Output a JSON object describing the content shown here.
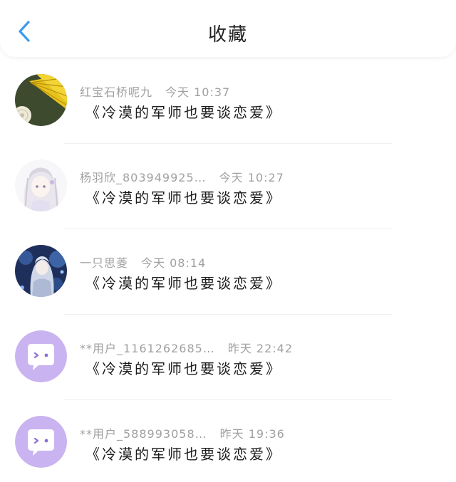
{
  "header": {
    "title": "收藏",
    "back_icon": "chevron-left-icon",
    "accent": "#3a9bf0"
  },
  "items": [
    {
      "user": "红宝石桥呢九",
      "time": "今天 10:37",
      "book": "《冷漠的军师也要谈恋爱》",
      "avatar": "yellow-fan-avatar"
    },
    {
      "user": "杨羽欣_803949925…",
      "time": "今天 10:27",
      "book": "《冷漠的军师也要谈恋爱》",
      "avatar": "anime-girl-sketch-avatar"
    },
    {
      "user": "一只思菱",
      "time": "今天 08:14",
      "book": "《冷漠的军师也要谈恋爱》",
      "avatar": "anime-girl-blue-avatar"
    },
    {
      "user": "**用户_1161262685…",
      "time": "昨天 22:42",
      "book": "《冷漠的军师也要谈恋爱》",
      "avatar": "default-chat-avatar"
    },
    {
      "user": "**用户_588993058…",
      "time": "昨天 19:36",
      "book": "《冷漠的军师也要谈恋爱》",
      "avatar": "default-chat-avatar"
    }
  ]
}
